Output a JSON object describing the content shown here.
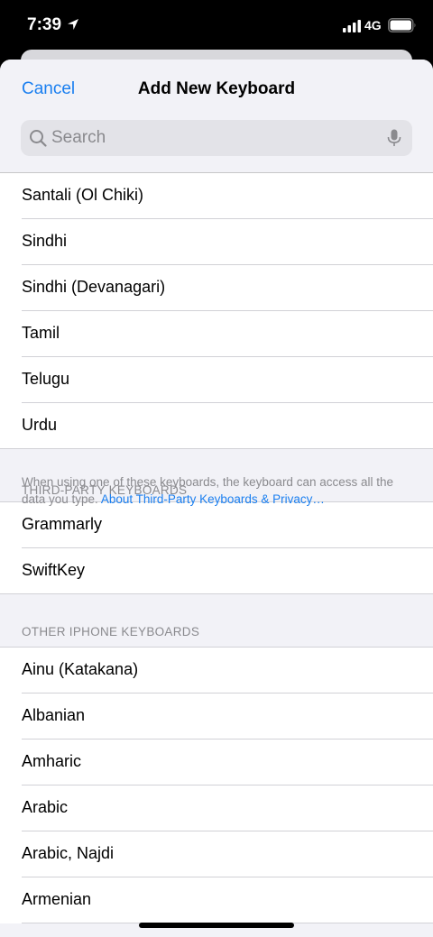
{
  "status_bar": {
    "time": "7:39",
    "network": "4G"
  },
  "nav": {
    "cancel_label": "Cancel",
    "title": "Add New Keyboard"
  },
  "search": {
    "placeholder": "Search"
  },
  "languages": [
    "Santali (Ol Chiki)",
    "Sindhi",
    "Sindhi (Devanagari)",
    "Tamil",
    "Telugu",
    "Urdu"
  ],
  "third_party": {
    "header": "THIRD-PARTY KEYBOARDS",
    "footer_text": "When using one of these keyboards, the keyboard can access all the data you type. ",
    "footer_link": "About Third-Party Keyboards & Privacy…",
    "items": [
      "Grammarly",
      "SwiftKey"
    ]
  },
  "other_keyboards": {
    "header": "OTHER IPHONE KEYBOARDS",
    "items": [
      "Ainu (Katakana)",
      "Albanian",
      "Amharic",
      "Arabic",
      "Arabic, Najdi",
      "Armenian"
    ]
  },
  "colors": {
    "accent": "#1a7ff0",
    "secondary_text": "#8a8a8e",
    "grouped_bg": "#f2f2f7"
  }
}
